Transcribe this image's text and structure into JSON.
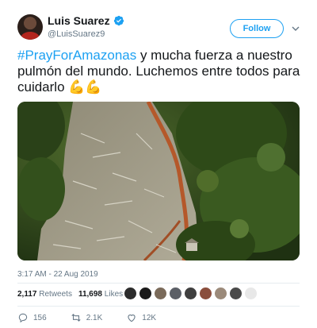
{
  "author": {
    "display_name": "Luis Suarez",
    "handle": "@LuisSuarez9"
  },
  "follow_label": "Follow",
  "tweet": {
    "hashtag": "#PrayForAmazonas",
    "text": " y mucha fuerza a nuestro pulmón del mundo. Luchemos entre todos para cuidarlo ",
    "emojis": "💪💪",
    "timestamp": "3:17 AM - 22 Aug 2019"
  },
  "stats": {
    "retweets_count": "2,117",
    "retweets_label": "Retweets",
    "likes_count": "11,698",
    "likes_label": "Likes"
  },
  "actions": {
    "replies": "156",
    "retweets": "2.1K",
    "likes": "12K"
  },
  "colors": {
    "brand": "#1da1f2",
    "text": "#14171a",
    "muted": "#657786"
  }
}
